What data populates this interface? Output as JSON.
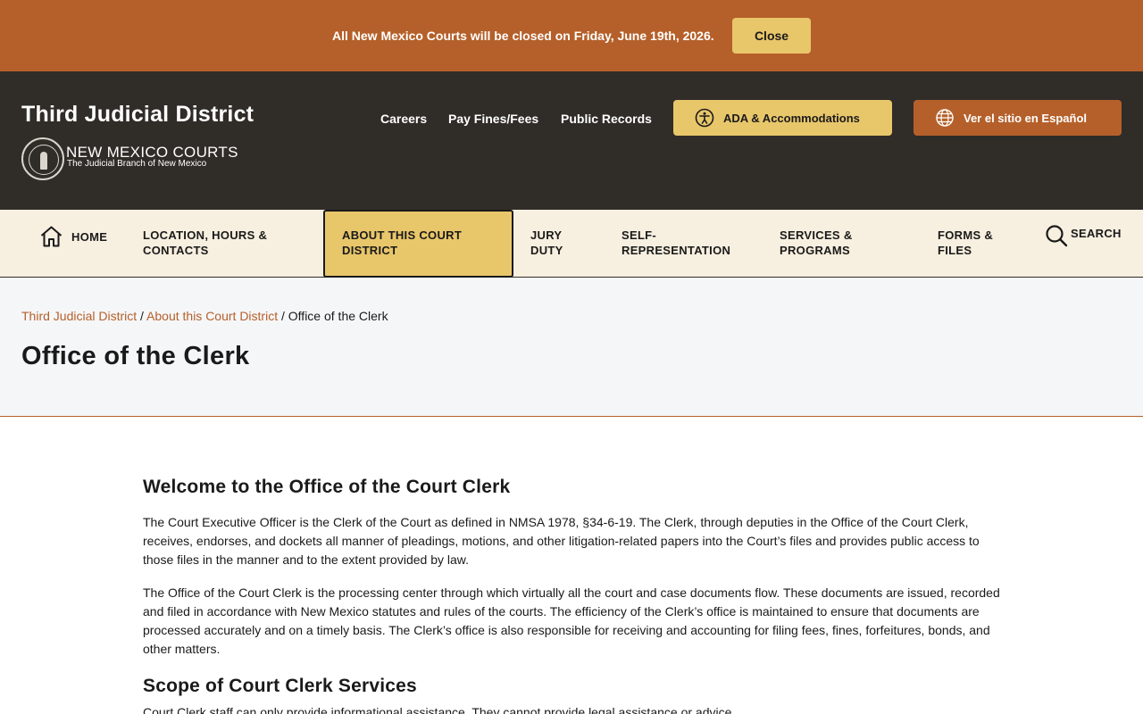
{
  "alert": {
    "message": "All New Mexico Courts will be closed on Friday, June 19th, 2026.",
    "close_label": "Close"
  },
  "header": {
    "site_title": "Third Judicial District",
    "courts_name": "NEW MEXICO COURTS",
    "courts_tagline": "The Judicial Branch of New Mexico",
    "utility_links": [
      "Careers",
      "Pay Fines/Fees",
      "Public Records"
    ],
    "ada_button": "ADA & Accommodations",
    "spanish_button": "Ver el sitio en Español"
  },
  "nav": {
    "home": "HOME",
    "location": [
      "LOCATION, HOURS &",
      "CONTACTS"
    ],
    "about": [
      "ABOUT THIS COURT",
      "DISTRICT"
    ],
    "jury": [
      "JURY",
      "DUTY"
    ],
    "self_rep": [
      "SELF-",
      "REPRESENTATION"
    ],
    "services": [
      "SERVICES &",
      "PROGRAMS"
    ],
    "forms": [
      "FORMS &",
      "FILES"
    ],
    "search": "SEARCH"
  },
  "breadcrumb": {
    "home": "Third Judicial District",
    "parent": "About this Court District",
    "current": "Office of the Clerk",
    "separator": " / "
  },
  "page_title": "Office of the Clerk",
  "content": {
    "heading1": "Welcome to the Office of the Court Clerk",
    "para1": "The Court Executive Officer is the Clerk of the Court as defined in NMSA 1978, §34-6-19. The Clerk, through deputies in the Office of the Court Clerk, receives, endorses, and dockets all manner of pleadings, motions, and other litigation-related papers into the Court’s files and provides public access to those files in the manner and to the extent provided by law.",
    "para2": "The Office of the Court Clerk is the processing center through which virtually all the court and case documents flow. These documents are issued, recorded and filed in accordance with New Mexico statutes and rules of the courts. The efficiency of the Clerk’s office is maintained to ensure that documents are processed accurately and on a timely basis. The Clerk’s office is also responsible for receiving and accounting for filing fees, fines, forfeitures, bonds, and other matters.",
    "heading2": "Scope of Court Clerk Services",
    "para3": "Court Clerk staff can only provide informational assistance. They cannot provide legal assistance or advice."
  },
  "colors": {
    "accent_orange": "#b5602a",
    "accent_gold": "#e8c66a",
    "header_dark": "#302c28",
    "nav_cream": "#f7efdf"
  },
  "icons": [
    "accessibility-icon",
    "globe-icon",
    "home-icon",
    "search-icon",
    "state-seal-icon"
  ]
}
